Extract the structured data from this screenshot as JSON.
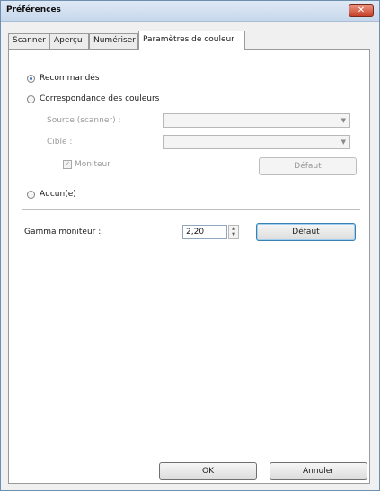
{
  "window": {
    "title": "Préférences"
  },
  "tabs": [
    {
      "label": "Scanner"
    },
    {
      "label": "Aperçu"
    },
    {
      "label": "Numériser"
    },
    {
      "label": "Paramètres de couleur"
    }
  ],
  "color_settings": {
    "recommended_label": "Recommandés",
    "matching_label": "Correspondance des couleurs",
    "source_label": "Source (scanner) :",
    "target_label": "Cible :",
    "monitor_label": "Moniteur",
    "monitor_checked": true,
    "default_button_disabled": "Défaut",
    "none_label": "Aucun(e)",
    "selected_option": "Recommandés"
  },
  "gamma": {
    "label": "Gamma moniteur :",
    "value": "2,20",
    "default_button": "Défaut"
  },
  "footer": {
    "ok": "OK",
    "cancel": "Annuler"
  }
}
